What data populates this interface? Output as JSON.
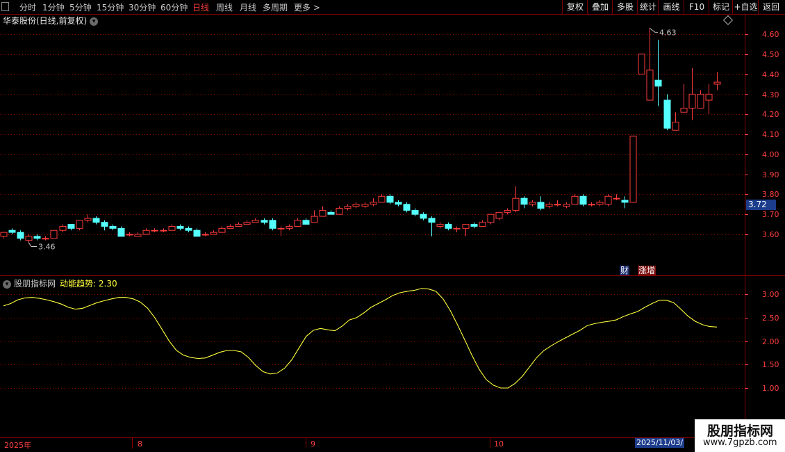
{
  "toolbar": {
    "periods": [
      "分时",
      "1分钟",
      "5分钟",
      "15分钟",
      "30分钟",
      "60分钟",
      "日线",
      "周线",
      "月线",
      "多周期",
      "更多 >"
    ],
    "active_period": "日线",
    "buttons": [
      "复权",
      "叠加",
      "多股",
      "统计",
      "画线",
      "F10",
      "+自选",
      "返回"
    ],
    "mark_label": "标记"
  },
  "main_title": "华泰股份(日线,前复权)",
  "indicator": {
    "source": "股朋指标网",
    "name": "动能趋势: 2.30"
  },
  "price_axis": [
    "4.60",
    "4.50",
    "4.40",
    "4.30",
    "4.20",
    "4.10",
    "4.00",
    "3.90",
    "3.80",
    "3.70",
    "3.60"
  ],
  "current_price": "3.72",
  "high_marker": "4.63",
  "low_marker": "3.46",
  "tags": {
    "cai": "财",
    "zhangzeng": "涨增"
  },
  "indicator_axis": [
    "3.00",
    "2.50",
    "2.00",
    "1.50",
    "1.00"
  ],
  "date_labels": [
    "2025年",
    "8",
    "9",
    "10"
  ],
  "cursor_date": "2025/11/03/",
  "watermark": {
    "title": "股朋指标网",
    "url": "www.7gpzb.com"
  },
  "colors": {
    "up": "#ff3c3c",
    "down": "#54ffff",
    "grid": "#8c0000",
    "indicator_line": "#ffff3c"
  },
  "chart_data": {
    "type": "candlestick",
    "candles": [
      [
        3.59,
        3.61,
        3.58,
        3.61
      ],
      [
        3.62,
        3.61,
        3.6,
        3.63
      ],
      [
        3.61,
        3.58,
        3.57,
        3.62
      ],
      [
        3.57,
        3.59,
        3.56,
        3.6
      ],
      [
        3.59,
        3.58,
        3.57,
        3.6
      ],
      [
        3.58,
        3.58,
        3.57,
        3.59
      ],
      [
        3.58,
        3.62,
        3.58,
        3.62
      ],
      [
        3.62,
        3.64,
        3.61,
        3.65
      ],
      [
        3.65,
        3.63,
        3.62,
        3.65
      ],
      [
        3.63,
        3.67,
        3.62,
        3.67
      ],
      [
        3.67,
        3.68,
        3.66,
        3.7
      ],
      [
        3.68,
        3.66,
        3.65,
        3.69
      ],
      [
        3.66,
        3.64,
        3.62,
        3.67
      ],
      [
        3.64,
        3.63,
        3.62,
        3.65
      ],
      [
        3.63,
        3.59,
        3.59,
        3.64
      ],
      [
        3.6,
        3.6,
        3.59,
        3.61
      ],
      [
        3.59,
        3.6,
        3.59,
        3.61
      ],
      [
        3.6,
        3.62,
        3.6,
        3.63
      ],
      [
        3.62,
        3.62,
        3.61,
        3.63
      ],
      [
        3.62,
        3.62,
        3.61,
        3.63
      ],
      [
        3.62,
        3.64,
        3.62,
        3.65
      ],
      [
        3.64,
        3.63,
        3.62,
        3.65
      ],
      [
        3.63,
        3.62,
        3.61,
        3.64
      ],
      [
        3.62,
        3.59,
        3.59,
        3.63
      ],
      [
        3.6,
        3.6,
        3.59,
        3.61
      ],
      [
        3.6,
        3.61,
        3.6,
        3.62
      ],
      [
        3.61,
        3.63,
        3.61,
        3.64
      ],
      [
        3.63,
        3.64,
        3.63,
        3.65
      ],
      [
        3.64,
        3.65,
        3.64,
        3.66
      ],
      [
        3.65,
        3.66,
        3.65,
        3.67
      ],
      [
        3.66,
        3.67,
        3.66,
        3.68
      ],
      [
        3.67,
        3.66,
        3.65,
        3.68
      ],
      [
        3.67,
        3.63,
        3.62,
        3.68
      ],
      [
        3.63,
        3.63,
        3.59,
        3.64
      ],
      [
        3.63,
        3.64,
        3.62,
        3.65
      ],
      [
        3.64,
        3.67,
        3.64,
        3.68
      ],
      [
        3.67,
        3.65,
        3.65,
        3.68
      ],
      [
        3.66,
        3.69,
        3.66,
        3.72
      ],
      [
        3.69,
        3.72,
        3.69,
        3.74
      ],
      [
        3.71,
        3.7,
        3.7,
        3.72
      ],
      [
        3.7,
        3.73,
        3.7,
        3.74
      ],
      [
        3.73,
        3.74,
        3.72,
        3.75
      ],
      [
        3.74,
        3.75,
        3.73,
        3.76
      ],
      [
        3.74,
        3.75,
        3.73,
        3.76
      ],
      [
        3.75,
        3.76,
        3.74,
        3.78
      ],
      [
        3.76,
        3.79,
        3.76,
        3.8
      ],
      [
        3.79,
        3.76,
        3.75,
        3.8
      ],
      [
        3.76,
        3.75,
        3.74,
        3.77
      ],
      [
        3.75,
        3.72,
        3.71,
        3.76
      ],
      [
        3.72,
        3.7,
        3.69,
        3.73
      ],
      [
        3.7,
        3.68,
        3.67,
        3.71
      ],
      [
        3.68,
        3.66,
        3.59,
        3.69
      ],
      [
        3.64,
        3.65,
        3.63,
        3.66
      ],
      [
        3.65,
        3.63,
        3.62,
        3.66
      ],
      [
        3.63,
        3.63,
        3.61,
        3.64
      ],
      [
        3.63,
        3.65,
        3.59,
        3.65
      ],
      [
        3.65,
        3.64,
        3.63,
        3.66
      ],
      [
        3.64,
        3.66,
        3.64,
        3.67
      ],
      [
        3.66,
        3.7,
        3.65,
        3.7
      ],
      [
        3.68,
        3.71,
        3.67,
        3.71
      ],
      [
        3.71,
        3.72,
        3.7,
        3.73
      ],
      [
        3.72,
        3.78,
        3.71,
        3.84
      ],
      [
        3.78,
        3.75,
        3.73,
        3.79
      ],
      [
        3.75,
        3.76,
        3.74,
        3.77
      ],
      [
        3.76,
        3.73,
        3.72,
        3.79
      ],
      [
        3.74,
        3.75,
        3.73,
        3.76
      ],
      [
        3.75,
        3.75,
        3.74,
        3.77
      ],
      [
        3.74,
        3.75,
        3.73,
        3.76
      ],
      [
        3.75,
        3.79,
        3.75,
        3.8
      ],
      [
        3.79,
        3.75,
        3.74,
        3.8
      ],
      [
        3.75,
        3.75,
        3.74,
        3.76
      ],
      [
        3.75,
        3.76,
        3.74,
        3.77
      ],
      [
        3.75,
        3.79,
        3.74,
        3.8
      ],
      [
        3.78,
        3.78,
        3.77,
        3.8
      ],
      [
        3.77,
        3.76,
        3.73,
        3.79
      ],
      [
        3.76,
        4.09,
        3.76,
        4.09
      ],
      [
        4.4,
        4.5,
        4.4,
        4.5
      ],
      [
        4.27,
        4.42,
        4.27,
        4.63
      ],
      [
        4.37,
        4.34,
        4.24,
        4.57
      ],
      [
        4.27,
        4.13,
        4.12,
        4.3
      ],
      [
        4.12,
        4.16,
        4.12,
        4.21
      ],
      [
        4.21,
        4.23,
        4.21,
        4.35
      ],
      [
        4.23,
        4.3,
        4.17,
        4.43
      ],
      [
        4.23,
        4.3,
        4.23,
        4.32
      ],
      [
        4.27,
        4.3,
        4.2,
        4.35
      ],
      [
        4.35,
        4.36,
        4.32,
        4.41
      ]
    ],
    "indicator_series": [
      2.75,
      2.8,
      2.88,
      2.92,
      2.93,
      2.91,
      2.88,
      2.84,
      2.79,
      2.72,
      2.68,
      2.7,
      2.76,
      2.82,
      2.86,
      2.9,
      2.93,
      2.93,
      2.9,
      2.83,
      2.7,
      2.5,
      2.25,
      2.0,
      1.8,
      1.7,
      1.65,
      1.63,
      1.64,
      1.7,
      1.76,
      1.8,
      1.8,
      1.77,
      1.65,
      1.48,
      1.35,
      1.3,
      1.32,
      1.42,
      1.6,
      1.85,
      2.1,
      2.23,
      2.27,
      2.24,
      2.22,
      2.32,
      2.45,
      2.5,
      2.6,
      2.72,
      2.8,
      2.88,
      2.97,
      3.03,
      3.06,
      3.08,
      3.12,
      3.11,
      3.06,
      2.9,
      2.65,
      2.35,
      2.03,
      1.7,
      1.4,
      1.18,
      1.06,
      1.0,
      1.0,
      1.1,
      1.25,
      1.45,
      1.65,
      1.8,
      1.9,
      1.99,
      2.07,
      2.15,
      2.23,
      2.33,
      2.37,
      2.4,
      2.42,
      2.45,
      2.52,
      2.58,
      2.63,
      2.72,
      2.8,
      2.87,
      2.87,
      2.82,
      2.68,
      2.53,
      2.42,
      2.35,
      2.31,
      2.3
    ],
    "ylim_price": [
      3.46,
      4.63
    ],
    "ylim_indicator": [
      1.0,
      3.0
    ]
  }
}
